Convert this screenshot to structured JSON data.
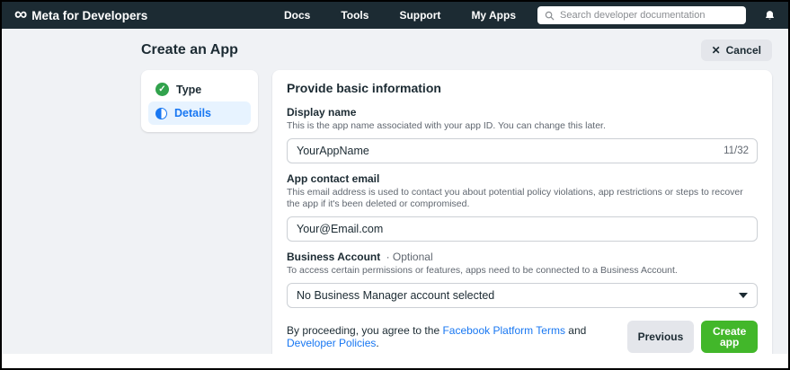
{
  "navbar": {
    "brand": "Meta for Developers",
    "logo_glyph": "∞",
    "links": [
      "Docs",
      "Tools",
      "Support",
      "My Apps"
    ],
    "search": {
      "placeholder": "Search developer documentation"
    }
  },
  "page": {
    "title": "Create an App",
    "cancel_label": "Cancel",
    "cancel_icon": "✕"
  },
  "stepper": {
    "steps": [
      {
        "label": "Type",
        "state": "complete",
        "icon": "check-circle"
      },
      {
        "label": "Details",
        "state": "current",
        "icon": "half-filled-circle"
      }
    ],
    "check_glyph": "✓"
  },
  "form": {
    "heading": "Provide basic information",
    "display_name": {
      "label": "Display name",
      "helper": "This is the app name associated with your app ID. You can change this later.",
      "value": "YourAppName",
      "counter": "11/32"
    },
    "contact_email": {
      "label": "App contact email",
      "helper": "This email address is used to contact you about potential policy violations, app restrictions or steps to recover the app if it's been deleted or compromised.",
      "value": "Your@Email.com"
    },
    "business_account": {
      "label": "Business Account",
      "optional_suffix": "· Optional",
      "helper": "To access certain permissions or features, apps need to be connected to a Business Account.",
      "selected_value": "No Business Manager account selected"
    },
    "agreement": {
      "prefix": "By proceeding, you agree to the ",
      "terms_link": "Facebook Platform Terms",
      "middle": " and ",
      "policies_link": "Developer Policies",
      "suffix": "."
    },
    "buttons": {
      "previous": "Previous",
      "create": "Create app"
    }
  },
  "colors": {
    "navbar_bg": "#1c2b33",
    "page_bg": "#f0f2f5",
    "accent_blue": "#1877f2",
    "active_step_bg": "#e7f3ff",
    "success_green": "#31a24c",
    "create_button_green": "#42b72a",
    "neutral_button_gray": "#e4e6eb"
  }
}
